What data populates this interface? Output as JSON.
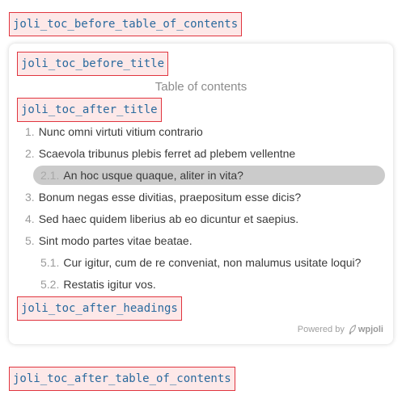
{
  "hooks": {
    "before_toc": "joli_toc_before_table_of_contents",
    "before_title": "joli_toc_before_title",
    "after_title": "joli_toc_after_title",
    "after_headings": "joli_toc_after_headings",
    "after_toc": "joli_toc_after_table_of_contents"
  },
  "toc": {
    "title": "Table of contents",
    "items": [
      {
        "num": "1.",
        "text": "Nunc omni virtuti vitium contrario"
      },
      {
        "num": "2.",
        "text": "Scaevola tribunus plebis ferret ad plebem vellentne"
      },
      {
        "num": "2.1.",
        "text": "An hoc usque quaque, aliter in vita?"
      },
      {
        "num": "3.",
        "text": "Bonum negas esse divitias, praepositum esse dicis?"
      },
      {
        "num": "4.",
        "text": "Sed haec quidem liberius ab eo dicuntur et saepius."
      },
      {
        "num": "5.",
        "text": "Sint modo partes vitae beatae."
      },
      {
        "num": "5.1.",
        "text": "Cur igitur, cum de re conveniat, non malumus usitate loqui?"
      },
      {
        "num": "5.2.",
        "text": "Restatis igitur vos."
      }
    ],
    "active_index": 2
  },
  "footer": {
    "powered_by": "Powered by",
    "brand": "wpjoli",
    "brand_icon": "joli-feather-icon"
  },
  "colors": {
    "hook_border": "#e0353f",
    "hook_bg": "#fde8e8",
    "hook_text": "#2a6a9e",
    "active_bg": "#cbcbcb"
  }
}
